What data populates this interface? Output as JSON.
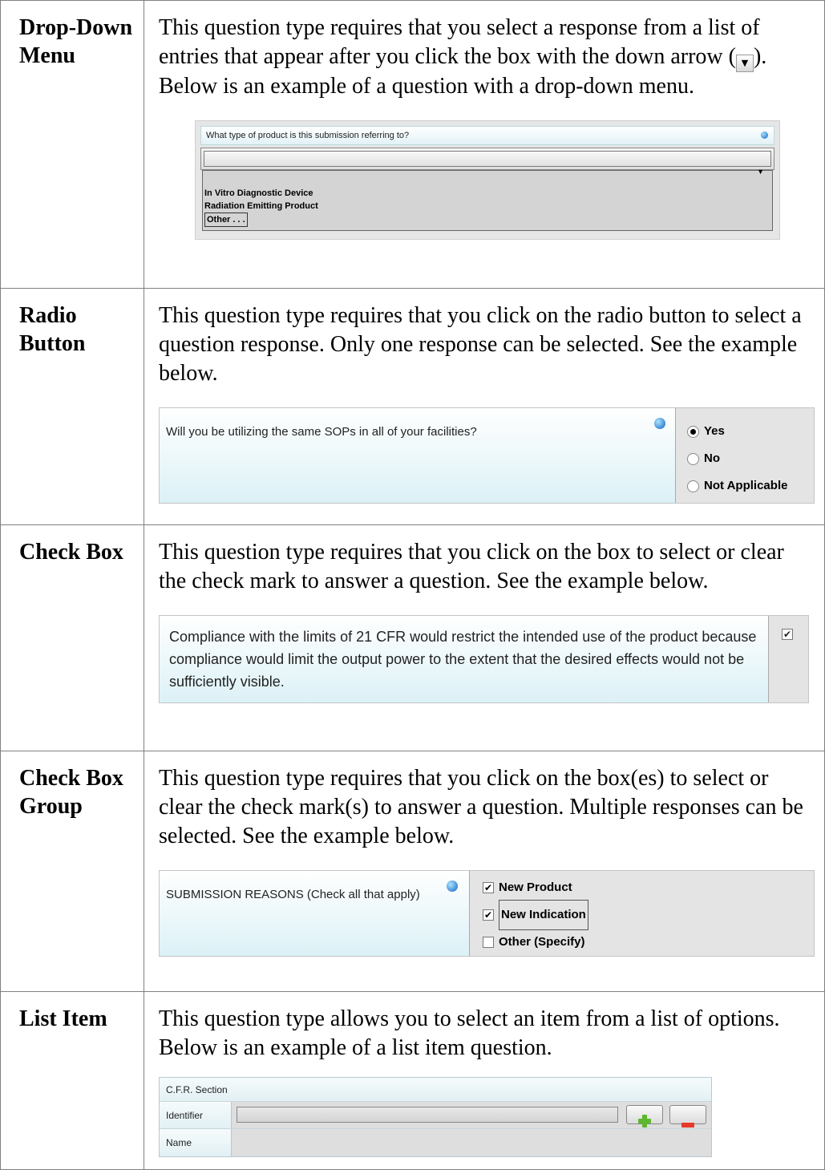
{
  "rows": [
    {
      "term": "Drop-Down Menu",
      "desc_before": "This question type requires that you select a response from a list of entries that appear after you click the box with the down arrow (",
      "desc_after": ").  Below is an example of a question with a drop-down menu.",
      "example": {
        "question": "What type of product is this submission referring to?",
        "options": [
          "In Vitro Diagnostic Device",
          "Radiation Emitting Product",
          "Other . . ."
        ]
      }
    },
    {
      "term": "Radio Button",
      "desc": "This question type requires that you click on the radio button to select a question response. Only one response can be selected. See the example below.",
      "example": {
        "question": "Will you be utilizing the same SOPs in all of your facilities?",
        "options": [
          "Yes",
          "No",
          "Not Applicable"
        ],
        "selected": "Yes"
      }
    },
    {
      "term": "Check Box",
      "desc": "This question type requires that you click on the box to select or clear the check mark to answer a question. See the example below.",
      "example": {
        "question": "Compliance with the limits of 21 CFR would restrict the intended use of the product because compliance would limit the output power to the extent that the desired effects would not be sufficiently visible.",
        "checked": true
      }
    },
    {
      "term": "Check Box Group",
      "desc": "This question type requires that you click on the box(es) to select or clear the check mark(s) to answer a question. Multiple responses can be selected. See the example below.",
      "example": {
        "question": "SUBMISSION REASONS (Check all that apply)",
        "options": [
          {
            "label": "New Product",
            "checked": true
          },
          {
            "label": "New Indication",
            "checked": true
          },
          {
            "label": "Other (Specify)",
            "checked": false
          }
        ]
      }
    },
    {
      "term": "List Item",
      "desc": "This question type allows you to select an item from a list of options.  Below is an example of a list item question.",
      "example": {
        "header": "C.F.R. Section",
        "fields": [
          "Identifier",
          "Name"
        ]
      }
    }
  ],
  "glyphs": {
    "down_arrow": "▼",
    "check": "✔"
  },
  "colors": {
    "accent_blue": "#1565c0",
    "plus_green": "#5cb82c",
    "minus_red": "#e53a2a"
  }
}
